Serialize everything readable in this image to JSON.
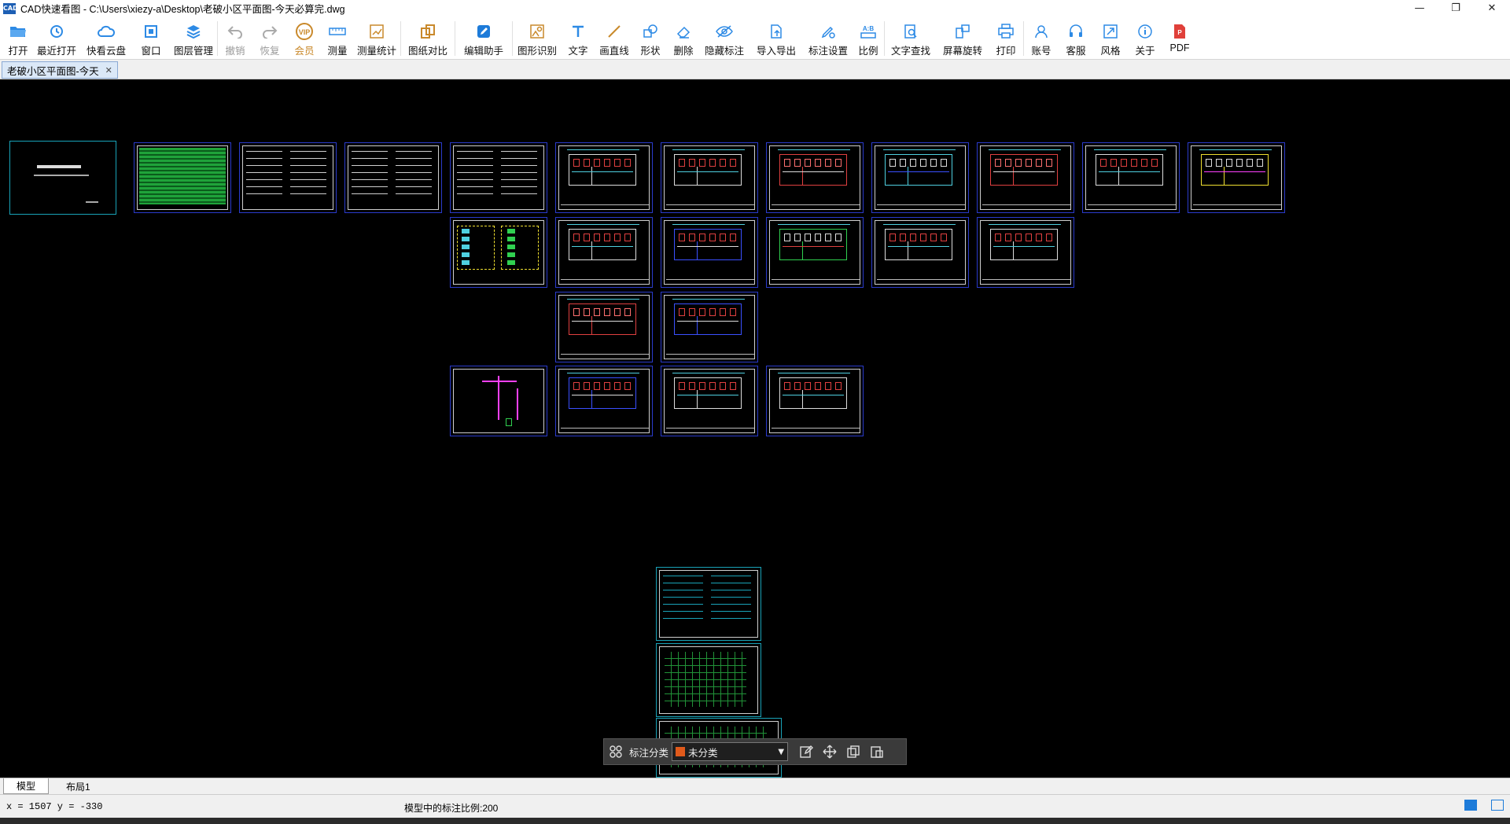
{
  "window": {
    "app_logo_text": "CAD",
    "title": "CAD快速看图 - C:\\Users\\xiezy-a\\Desktop\\老破小区平面图-今天必算完.dwg",
    "minimize": "—",
    "maximize": "❐",
    "close": "✕"
  },
  "toolbar": {
    "items": [
      {
        "key": "open",
        "label": "打开",
        "icon": "folder-icon"
      },
      {
        "key": "recent",
        "label": "最近打开",
        "icon": "history-icon"
      },
      {
        "key": "cloud",
        "label": "快看云盘",
        "icon": "cloud-icon"
      },
      {
        "key": "window",
        "label": "窗口",
        "icon": "window-icon"
      },
      {
        "key": "layers",
        "label": "图层管理",
        "icon": "layers-icon"
      },
      {
        "key": "undo",
        "label": "撤销",
        "icon": "undo-icon"
      },
      {
        "key": "redo",
        "label": "恢复",
        "icon": "redo-icon"
      },
      {
        "key": "vip",
        "label": "会员",
        "icon": "vip-icon"
      },
      {
        "key": "measure",
        "label": "测量",
        "icon": "ruler-icon"
      },
      {
        "key": "measure_stats",
        "label": "测量统计",
        "icon": "chart-icon"
      },
      {
        "key": "compare",
        "label": "图纸对比",
        "icon": "compare-icon"
      },
      {
        "key": "edit_helper",
        "label": "编辑助手",
        "icon": "edit-helper-icon"
      },
      {
        "key": "shape_recog",
        "label": "图形识别",
        "icon": "shape-recognize-icon"
      },
      {
        "key": "text",
        "label": "文字",
        "icon": "text-icon"
      },
      {
        "key": "line",
        "label": "画直线",
        "icon": "line-icon"
      },
      {
        "key": "shape",
        "label": "形状",
        "icon": "shape-icon"
      },
      {
        "key": "delete",
        "label": "删除",
        "icon": "eraser-icon"
      },
      {
        "key": "hide_anno",
        "label": "隐藏标注",
        "icon": "eye-off-icon"
      },
      {
        "key": "import_export",
        "label": "导入导出",
        "icon": "import-export-icon"
      },
      {
        "key": "anno_settings",
        "label": "标注设置",
        "icon": "annotation-settings-icon"
      },
      {
        "key": "scale",
        "label": "比例",
        "icon": "scale-icon"
      },
      {
        "key": "text_search",
        "label": "文字查找",
        "icon": "text-search-icon"
      },
      {
        "key": "rotate",
        "label": "屏幕旋转",
        "icon": "rotate-icon"
      },
      {
        "key": "print",
        "label": "打印",
        "icon": "printer-icon"
      },
      {
        "key": "account",
        "label": "账号",
        "icon": "user-icon"
      },
      {
        "key": "service",
        "label": "客服",
        "icon": "headset-icon"
      },
      {
        "key": "style",
        "label": "风格",
        "icon": "style-icon"
      },
      {
        "key": "about",
        "label": "关于",
        "icon": "info-icon"
      },
      {
        "key": "pdf",
        "label": "PDF",
        "icon": "pdf-icon"
      }
    ],
    "vip_badge": "VIP",
    "scale_badge": "A:B",
    "pdf_badge": "P"
  },
  "doc_tab": {
    "label": "老破小区平面图-今天",
    "close": "✕"
  },
  "floatbar": {
    "category_label": "标注分类",
    "category_value": "未分类",
    "swatch_color": "#e05a1b"
  },
  "layout_tabs": [
    {
      "label": "模型",
      "active": true
    },
    {
      "label": "布局1",
      "active": false
    }
  ],
  "status": {
    "coords": "x = 1507  y = -330",
    "scale_text": "模型中的标注比例:200"
  },
  "colors": {
    "accent": "#1d7bd9",
    "vip": "#c9892b",
    "drawing_frame_blue": "#2a3bcc",
    "canvas": "#000000"
  }
}
